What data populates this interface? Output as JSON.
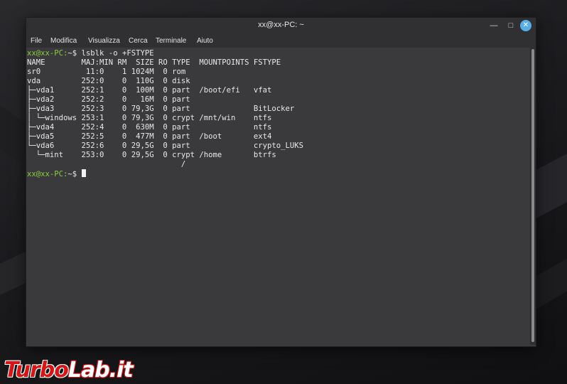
{
  "window": {
    "title": "xx@xx-PC: ~",
    "controls": {
      "minimize_icon": "minimize-icon",
      "maximize_icon": "maximize-icon",
      "close_icon": "close-icon"
    }
  },
  "menu": {
    "file": "File",
    "edit": "Modifica",
    "view": "Visualizza",
    "search": "Cerca",
    "terminal": "Terminale",
    "help": "Aiuto"
  },
  "terminal": {
    "prompt_user": "xx@xx-PC:",
    "prompt_path": "~$",
    "command": " lsblk -o +FSTYPE",
    "lines": [
      "NAME        MAJ:MIN RM  SIZE RO TYPE  MOUNTPOINTS FSTYPE",
      "sr0          11:0    1 1024M  0 rom",
      "vda         252:0    0  110G  0 disk",
      "├─vda1      252:1    0  100M  0 part  /boot/efi   vfat",
      "├─vda2      252:2    0   16M  0 part",
      "├─vda3      252:3    0 79,3G  0 part              BitLocker",
      "│ └─windows 253:1    0 79,3G  0 crypt /mnt/win    ntfs",
      "├─vda4      252:4    0  630M  0 part              ntfs",
      "├─vda5      252:5    0  477M  0 part  /boot       ext4",
      "└─vda6      252:6    0 29,5G  0 part              crypto_LUKS",
      "  └─mint    253:0    0 29,5G  0 crypt /home       btrfs",
      "                                  /"
    ]
  },
  "watermark": {
    "part1": "Turbo",
    "part2": "Lab.it"
  },
  "colors": {
    "prompt": "#8ccd3b",
    "background": "#3a3a3d",
    "close_button": "#5aaee6"
  }
}
